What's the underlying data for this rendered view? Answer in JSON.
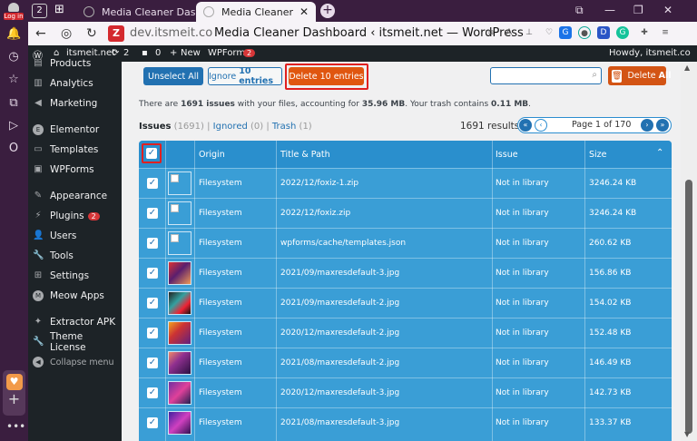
{
  "opera": {
    "login_label": "Log in"
  },
  "tabs": {
    "workspace_count": "2",
    "items": [
      {
        "title": "Media Cleaner Dashbo"
      },
      {
        "title": "Media Cleaner Dashbo"
      }
    ]
  },
  "address": {
    "url": "dev.itsmeit.co",
    "page_title": "Media Cleaner Dashboard ‹ itsmeit.net — WordPress",
    "site_icon_letter": "Z"
  },
  "adminbar": {
    "site_name": "itsmeit.net",
    "updates_count": "2",
    "comments_count": "0",
    "new_label": "New",
    "wpforms_label": "WPForms",
    "wpforms_badge": "2",
    "howdy": "Howdy, itsmeit.co"
  },
  "menu": {
    "items": [
      {
        "label": "Products"
      },
      {
        "label": "Analytics"
      },
      {
        "label": "Marketing"
      },
      {
        "label": "Elementor"
      },
      {
        "label": "Templates"
      },
      {
        "label": "WPForms"
      },
      {
        "label": "Appearance"
      },
      {
        "label": "Plugins",
        "badge": "2"
      },
      {
        "label": "Users"
      },
      {
        "label": "Tools"
      },
      {
        "label": "Settings"
      },
      {
        "label": "Meow Apps"
      },
      {
        "label": "Extractor APK"
      },
      {
        "label": "Theme License"
      },
      {
        "label": "Collapse menu"
      }
    ]
  },
  "toolbar": {
    "unselect_all": "Unselect All",
    "ignore_prefix": "Ignore ",
    "ignore_count": "10 entries",
    "delete_label": "Delete 10 entries",
    "search_placeholder": "",
    "delete_all_prefix": "Delete ",
    "delete_all_bold": "All"
  },
  "summary": {
    "text1": "There are ",
    "issues_count": "1691 issues",
    "text2": " with your files, accounting for ",
    "size": "35.96 MB",
    "text3": ". Your trash contains ",
    "trash_size": "0.11 MB",
    "text4": "."
  },
  "filters": {
    "issues_label": "Issues",
    "issues_count": "(1691)",
    "sep1": " | ",
    "ignored_label": "Ignored",
    "ignored_count": "(0)",
    "sep2": " | ",
    "trash_label": "Trash",
    "trash_count": "(1)"
  },
  "pagination": {
    "results": "1691 results",
    "page_label": "Page 1 of 170"
  },
  "table": {
    "columns": [
      "Origin",
      "Title & Path",
      "Issue",
      "Size"
    ],
    "rows": [
      {
        "origin": "Filesystem",
        "path": "2022/12/foxiz-1.zip",
        "issue": "Not in library",
        "size": "3246.24 KB"
      },
      {
        "origin": "Filesystem",
        "path": "2022/12/foxiz.zip",
        "issue": "Not in library",
        "size": "3246.24 KB"
      },
      {
        "origin": "Filesystem",
        "path": "wpforms/cache/templates.json",
        "issue": "Not in library",
        "size": "260.62 KB"
      },
      {
        "origin": "Filesystem",
        "path": "2021/09/maxresdefault-3.jpg",
        "issue": "Not in library",
        "size": "156.86 KB"
      },
      {
        "origin": "Filesystem",
        "path": "2021/09/maxresdefault-2.jpg",
        "issue": "Not in library",
        "size": "154.02 KB"
      },
      {
        "origin": "Filesystem",
        "path": "2020/12/maxresdefault-2.jpg",
        "issue": "Not in library",
        "size": "152.48 KB"
      },
      {
        "origin": "Filesystem",
        "path": "2021/08/maxresdefault-2.jpg",
        "issue": "Not in library",
        "size": "146.49 KB"
      },
      {
        "origin": "Filesystem",
        "path": "2020/12/maxresdefault-3.jpg",
        "issue": "Not in library",
        "size": "142.73 KB"
      },
      {
        "origin": "Filesystem",
        "path": "2021/08/maxresdefault-3.jpg",
        "issue": "Not in library",
        "size": "133.37 KB"
      }
    ]
  }
}
